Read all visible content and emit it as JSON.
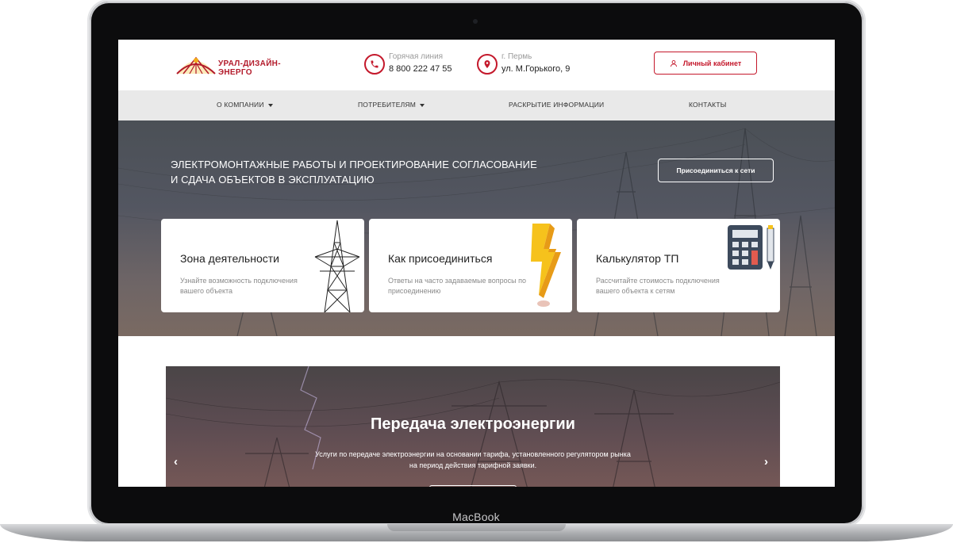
{
  "device": {
    "brand_label": "MacBook"
  },
  "header": {
    "logo_text": "УРАЛ-ДИЗАЙН-ЭНЕРГО",
    "hotline": {
      "label": "Горячая линия",
      "value": "8 800 222 47 55",
      "icon": "phone-icon"
    },
    "address": {
      "label": "г. Пермь",
      "value": "ул. М.Горького, 9",
      "icon": "map-pin-icon"
    },
    "cabinet_label": "Личный кабинет",
    "cabinet_icon": "user-icon"
  },
  "nav": {
    "items": [
      {
        "label": "О КОМПАНИИ",
        "dropdown": true
      },
      {
        "label": "ПОТРЕБИТЕЛЯМ",
        "dropdown": true
      },
      {
        "label": "РАСКРЫТИЕ ИНФОРМАЦИИ",
        "dropdown": false
      },
      {
        "label": "КОНТАКТЫ",
        "dropdown": false
      }
    ]
  },
  "hero": {
    "title_line1": "ЭЛЕКТРОМОНТАЖНЫЕ РАБОТЫ И ПРОЕКТИРОВАНИЕ СОГЛАСОВАНИЕ",
    "title_line2": "И СДАЧА ОБЪЕКТОВ В ЭКСПЛУАТАЦИЮ",
    "join_button": "Присоединиться к сети",
    "cards": [
      {
        "title": "Зона деятельности",
        "text": "Узнайте возможность подключения вашего объекта",
        "icon": "power-tower-icon"
      },
      {
        "title": "Как присоединиться",
        "text": "Ответы на часто задаваемые вопросы по присоединению",
        "icon": "lightning-bolt-icon"
      },
      {
        "title": "Калькулятор ТП",
        "text": "Рассчитайте стоимость подключения вашего объекта к сетям",
        "icon": "calculator-icon"
      }
    ]
  },
  "carousel": {
    "title": "Передача электроэнергии",
    "text_line1": "Услуги по передаче электроэнергии на основании тарифа, установленного регулятором рынка",
    "text_line2": "на период действия тарифной заявки.",
    "prev": "‹",
    "next": "›"
  },
  "colors": {
    "accent": "#c4182b",
    "nav_bg": "#e9e9e9"
  }
}
